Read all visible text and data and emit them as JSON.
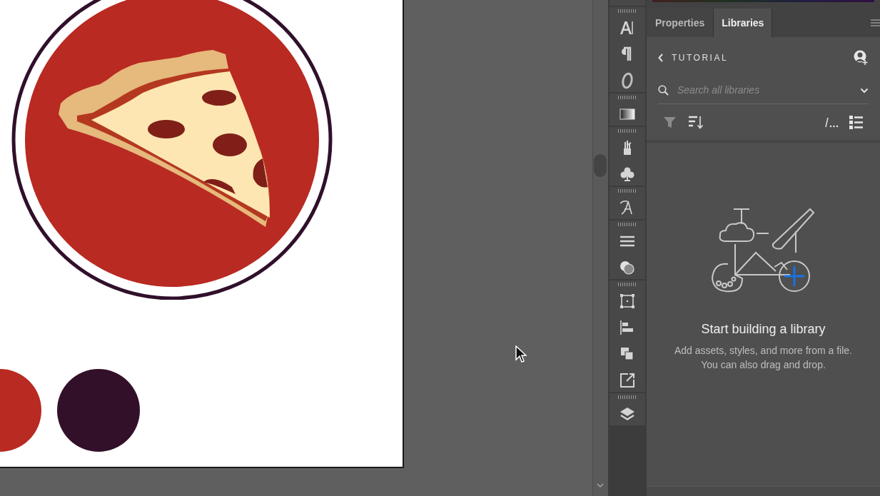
{
  "panel": {
    "tabs": [
      {
        "label": "Properties",
        "selected": false
      },
      {
        "label": "Libraries",
        "selected": true
      }
    ],
    "library_name": "TUTORIAL",
    "search": {
      "placeholder": "Search all libraries"
    },
    "empty_state": {
      "title": "Start building a library",
      "description": "Add assets, styles, and more from a file. You can also drag and drop."
    }
  }
}
